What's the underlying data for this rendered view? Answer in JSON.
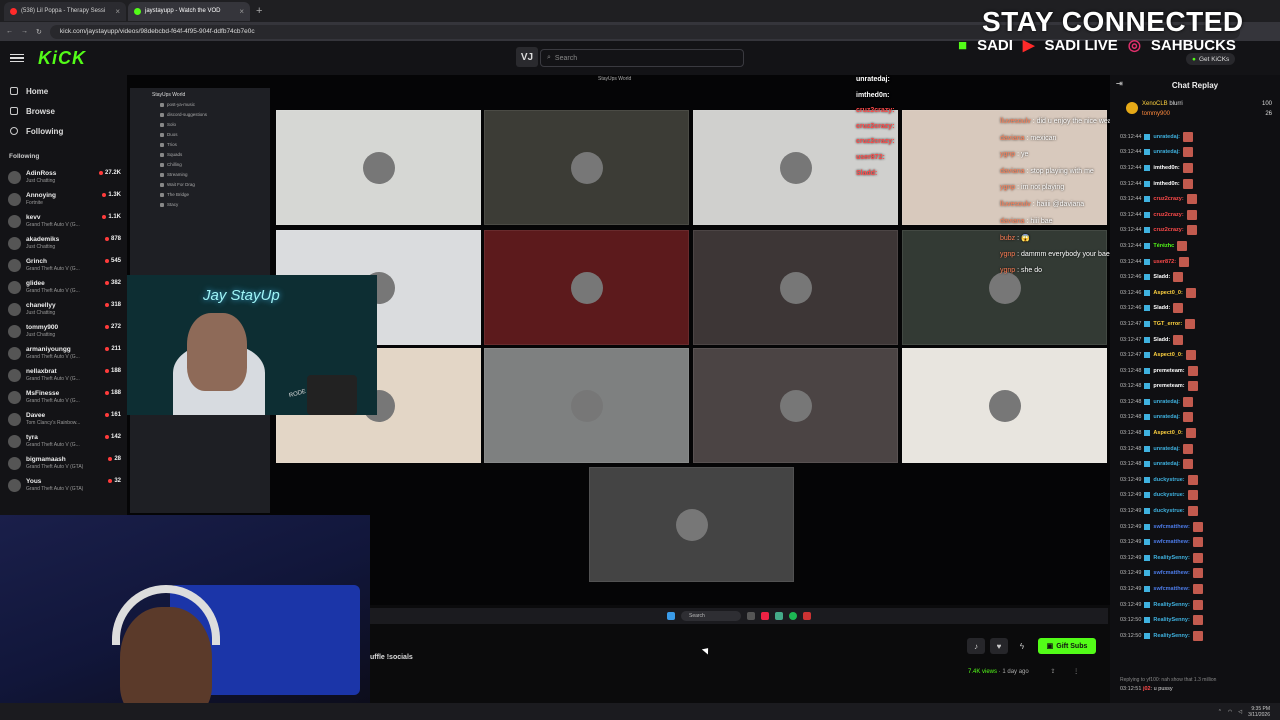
{
  "browser": {
    "tabs": [
      {
        "label": "(538) Lil Poppa - Therapy Sessi",
        "icon_color": "#ff2a2a"
      },
      {
        "label": "jaystayupp - Watch the VOD",
        "icon_color": "#53fc18"
      }
    ],
    "url": "kick.com/jaystayupp/videos/98debcbd-f64f-4f95-904f-ddfb74cb7e0c"
  },
  "header": {
    "logo": "KiCK",
    "vj_badge": "VJ",
    "search_placeholder": "Search",
    "get_kicks": "Get KiCKs"
  },
  "overlay": {
    "title": "STAY CONNECTED",
    "kick": "SADI",
    "youtube": "SADI LIVE",
    "instagram": "SAHBUCKS"
  },
  "nav": {
    "home": "Home",
    "browse": "Browse",
    "following": "Following"
  },
  "following_section": {
    "header": "Following",
    "items": [
      {
        "name": "AdinRoss",
        "game": "Just Chatting",
        "count": "27.2K"
      },
      {
        "name": "Annoying",
        "game": "Fortnite",
        "count": "1.3K"
      },
      {
        "name": "kevv",
        "game": "Grand Theft Auto V (G...",
        "count": "1.1K"
      },
      {
        "name": "akademiks",
        "game": "Just Chatting",
        "count": "878"
      },
      {
        "name": "Grinch",
        "game": "Grand Theft Auto V (G...",
        "count": "545"
      },
      {
        "name": "glidee",
        "game": "Grand Theft Auto V (G...",
        "count": "382"
      },
      {
        "name": "chanellyy",
        "game": "Just Chatting",
        "count": "318"
      },
      {
        "name": "tommy900",
        "game": "Just Chatting",
        "count": "272"
      },
      {
        "name": "armaniyoungg",
        "game": "Grand Theft Auto V (G...",
        "count": "211"
      },
      {
        "name": "nellaxbrat",
        "game": "Grand Theft Auto V (G...",
        "count": "188"
      },
      {
        "name": "MsFinesse",
        "game": "Grand Theft Auto V (G...",
        "count": "188"
      },
      {
        "name": "Davee",
        "game": "Tom Clancy's Rainbow...",
        "count": "161"
      },
      {
        "name": "tyra",
        "game": "Grand Theft Auto V (G...",
        "count": "142"
      },
      {
        "name": "bigmamaash",
        "game": "Grand Theft Auto V (GTA)",
        "count": "28"
      },
      {
        "name": "Yous",
        "game": "Grand Theft Auto V (GTA)",
        "count": "32"
      }
    ]
  },
  "stream": {
    "window_title": "StayUps World",
    "discord_server": "StayUps World",
    "discord_channels": [
      "post-ya-music",
      "discord-suggestions",
      "Solo",
      "Duos",
      "Trios",
      "Squads",
      "Chilling",
      "Streaming",
      "Wait For Drag",
      "The Bridge",
      "Stacy"
    ],
    "neon_sign": "Jay StayUp",
    "mic_label": "RODE",
    "overlay_chat": [
      {
        "user": "lluvesoulv",
        "text": "did u enjoy the nice weather"
      },
      {
        "user": "daviana",
        "text": "mexican"
      },
      {
        "user": "ygnp",
        "text": "ye"
      },
      {
        "user": "daviana",
        "text": "stop playing with me"
      },
      {
        "user": "ygnp",
        "text": "im not playing"
      },
      {
        "user": "lluvesoulv",
        "text": "haiiii @daviana"
      },
      {
        "user": "daviana",
        "text": "hiii bae"
      },
      {
        "user": "bubz",
        "text": "😱"
      },
      {
        "user": "ygnp",
        "text": "dammm everybody your bae"
      },
      {
        "user": "ygnp",
        "text": "she do"
      }
    ],
    "overlay_chat_left": [
      {
        "user": "unratedaj:"
      },
      {
        "user": "imthed0n:"
      },
      {
        "user": "cruz2crazy:"
      },
      {
        "user": "cruz2crazy:"
      },
      {
        "user": "cruz2crazy:"
      },
      {
        "user": "user872:"
      },
      {
        "user": "Sladd:"
      }
    ],
    "taskbar_search": "Search"
  },
  "info": {
    "shuffle_text": "uffle !socials",
    "gift_subs": "Gift Subs",
    "views": "7.4K views",
    "ago": "1 day ago"
  },
  "chat": {
    "title": "Chat Replay",
    "leaderboard": [
      {
        "user": "XenoCLB",
        "text": "blurri",
        "amount": "100"
      },
      {
        "user": "tommy900",
        "text": "",
        "amount": "26"
      }
    ],
    "messages": [
      {
        "time": "03:12:44",
        "user": "unratedaj:",
        "color": "#3fb2e0"
      },
      {
        "time": "03:12:44",
        "user": "unratedaj:",
        "color": "#3fb2e0"
      },
      {
        "time": "03:12:44",
        "user": "imthed0n:",
        "color": "#ffffff"
      },
      {
        "time": "03:12:44",
        "user": "imthed0n:",
        "color": "#ffffff"
      },
      {
        "time": "03:12:44",
        "user": "cruz2crazy:",
        "color": "#ff4a4a"
      },
      {
        "time": "03:12:44",
        "user": "cruz2crazy:",
        "color": "#ff4a4a"
      },
      {
        "time": "03:12:44",
        "user": "cruz2crazy:",
        "color": "#ff4a4a"
      },
      {
        "time": "03:12:44",
        "user": "Térézhc",
        "color": "#53fc18"
      },
      {
        "time": "03:12:44",
        "user": "user872:",
        "color": "#ff4a4a"
      },
      {
        "time": "03:12:46",
        "user": "Sladd:",
        "color": "#ffffff"
      },
      {
        "time": "03:12:46",
        "user": "Aspect0_0:",
        "color": "#ffd23f"
      },
      {
        "time": "03:12:46",
        "user": "Sladd:",
        "color": "#ffffff"
      },
      {
        "time": "03:12:47",
        "user": "TGT_error:",
        "color": "#ffd23f"
      },
      {
        "time": "03:12:47",
        "user": "Sladd:",
        "color": "#ffffff"
      },
      {
        "time": "03:12:47",
        "user": "Aspect0_0:",
        "color": "#ffd23f"
      },
      {
        "time": "03:12:48",
        "user": "premeteam:",
        "color": "#ffffff"
      },
      {
        "time": "03:12:48",
        "user": "premeteam:",
        "color": "#ffffff"
      },
      {
        "time": "03:12:48",
        "user": "unratedaj:",
        "color": "#3fb2e0"
      },
      {
        "time": "03:12:48",
        "user": "unratedaj:",
        "color": "#3fb2e0"
      },
      {
        "time": "03:12:48",
        "user": "Aspect0_0:",
        "color": "#ffd23f"
      },
      {
        "time": "03:12:48",
        "user": "unratedaj:",
        "color": "#3fb2e0"
      },
      {
        "time": "03:12:48",
        "user": "unratedaj:",
        "color": "#3fb2e0"
      },
      {
        "time": "03:12:49",
        "user": "duckystrue:",
        "color": "#3fb2e0"
      },
      {
        "time": "03:12:49",
        "user": "duckystrue:",
        "color": "#3fb2e0"
      },
      {
        "time": "03:12:49",
        "user": "duckystrue:",
        "color": "#3fb2e0"
      },
      {
        "time": "03:12:49",
        "user": "swfcmatthew:",
        "color": "#4c7be8"
      },
      {
        "time": "03:12:49",
        "user": "swfcmatthew:",
        "color": "#4c7be8"
      },
      {
        "time": "03:12:49",
        "user": "RealitySenny:",
        "color": "#3fb2e0"
      },
      {
        "time": "03:12:49",
        "user": "swfcmatthew:",
        "color": "#4c7be8"
      },
      {
        "time": "03:12:49",
        "user": "swfcmatthew:",
        "color": "#4c7be8"
      },
      {
        "time": "03:12:49",
        "user": "RealitySenny:",
        "color": "#3fb2e0"
      },
      {
        "time": "03:12:50",
        "user": "RealitySenny:",
        "color": "#3fb2e0"
      },
      {
        "time": "03:12:50",
        "user": "RealitySenny:",
        "color": "#3fb2e0"
      }
    ],
    "replying_to": "Replying to yf100: nah show that 1.3 million",
    "last_msg": {
      "time": "03:12:51",
      "user": "j02",
      "text": "u pussy"
    }
  },
  "taskbar": {
    "time": "9:35 PM",
    "date": "3/11/2026"
  }
}
